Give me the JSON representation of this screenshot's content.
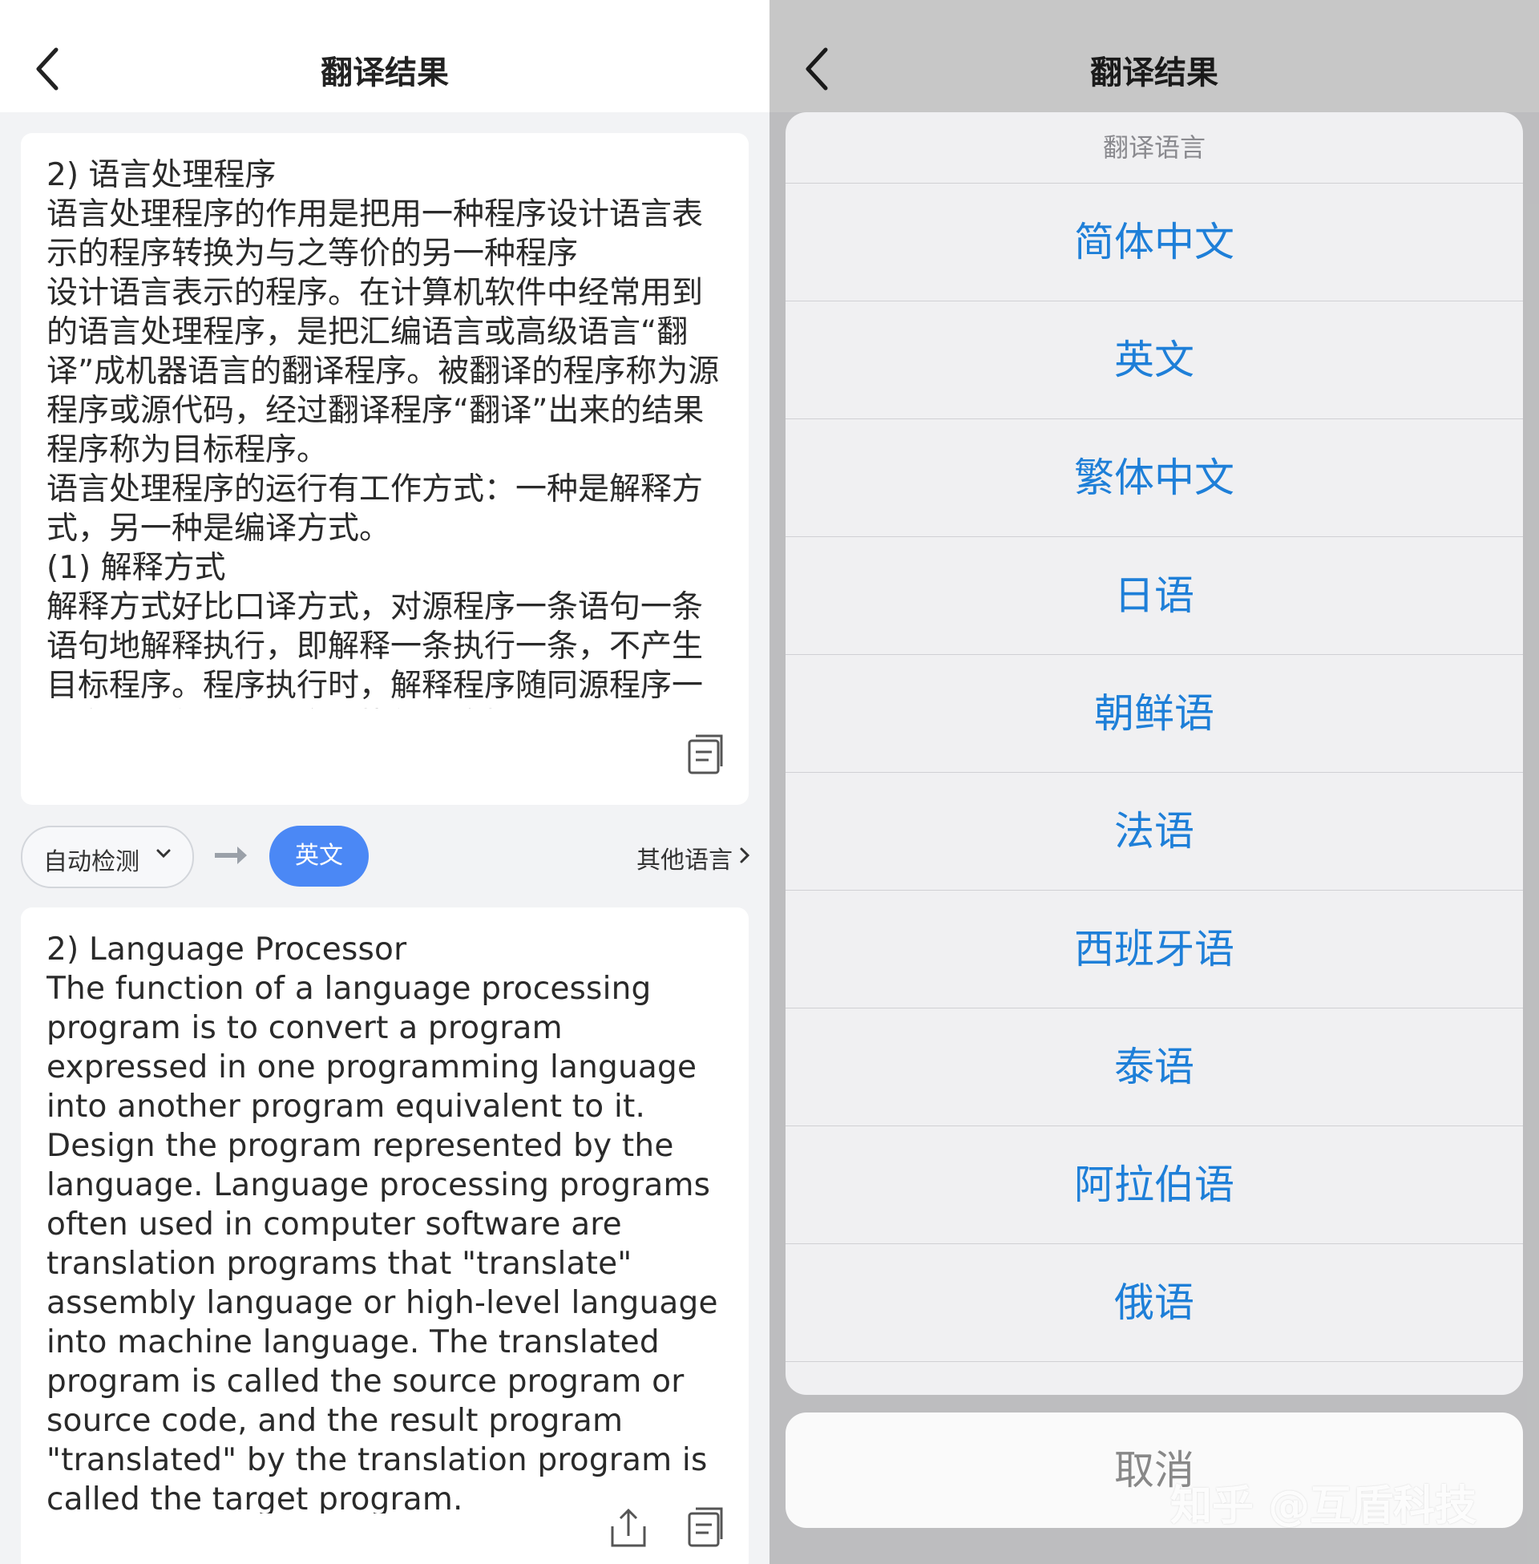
{
  "left": {
    "header": {
      "title": "翻译结果"
    },
    "source_text": "2) 语言处理程序\n语言处理程序的作用是把用一种程序设计语言表示的程序转换为与之等价的另一种程序\n设计语言表示的程序。在计算机软件中经常用到的语言处理程序，是把汇编语言或高级语言“翻译”成机器语言的翻译程序。被翻译的程序称为源程序或源代码，经过翻译程序“翻译”出来的结果程序称为目标程序。\n语言处理程序的运行有工作方式：一种是解释方式，另一种是编译方式。\n(1) 解释方式\n解释方式好比口译方式，对源程序一条语句一条语句地解释执行，即解释一条执行一条，不产生目标程序。程序执行时，解释程序随同源程序一起参与运行，解释方式执行速度慢，但",
    "lang_bar": {
      "source_lang": "自动检测",
      "target_lang": "英文",
      "other_lang": "其他语言"
    },
    "translated_text": "2) Language Processor\nThe function of a language processing program is to convert a program expressed in one programming language into another program equivalent to it.\nDesign the program represented by the language. Language processing programs often used in computer software are translation programs that \"translate\" assembly language or high-level language into machine language. The translated program is called the source program or source code, and the result program \"translated\" by the translation program is called the target program."
  },
  "right": {
    "header": {
      "title": "翻译结果"
    },
    "sheet": {
      "title": "翻译语言",
      "options": [
        "简体中文",
        "英文",
        "繁体中文",
        "日语",
        "朝鲜语",
        "法语",
        "西班牙语",
        "泰语",
        "阿拉伯语",
        "俄语"
      ],
      "cancel": "取消"
    },
    "watermark": "知乎 @互盾科技"
  },
  "colors": {
    "accent": "#4b88f5",
    "option_text": "#1e7fd8",
    "page_bg": "#f2f3f5"
  }
}
